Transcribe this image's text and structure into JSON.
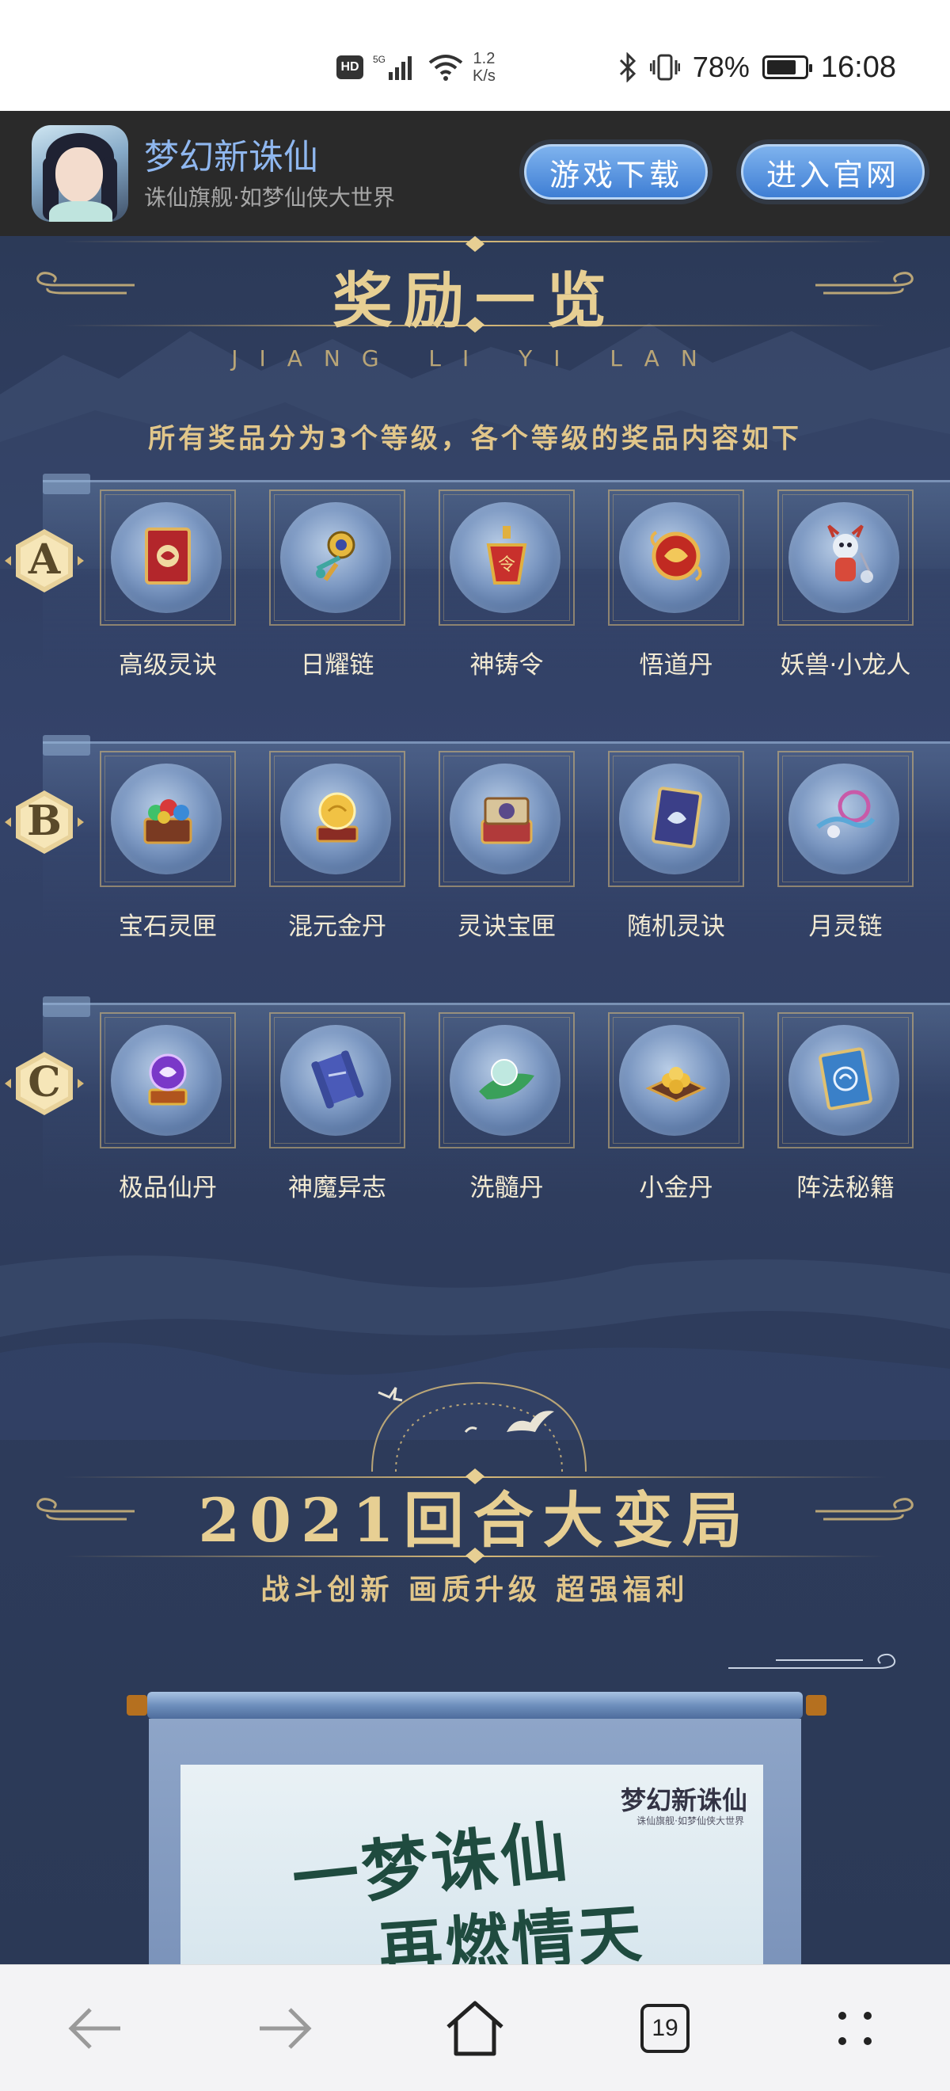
{
  "status_bar": {
    "hd": "HD",
    "net_speed_value": "1.2",
    "net_speed_unit": "K/s",
    "battery_pct": "78%",
    "battery_level": 0.78,
    "time": "16:08"
  },
  "app_banner": {
    "title": "梦幻新诛仙",
    "subtitle": "诛仙旗舰·如梦仙侠大世界",
    "download_label": "游戏下载",
    "official_label": "进入官网"
  },
  "rewards": {
    "title": "奖励一览",
    "pinyin": "JIANG LI YI LAN",
    "description": "所有奖品分为3个等级，各个等级的奖品内容如下",
    "tiers": [
      {
        "letter": "A",
        "items": [
          {
            "label": "高级灵诀",
            "icon": "red-book-icon"
          },
          {
            "label": "日耀链",
            "icon": "gold-chain-icon"
          },
          {
            "label": "神铸令",
            "icon": "red-token-icon"
          },
          {
            "label": "悟道丹",
            "icon": "red-pill-icon"
          },
          {
            "label": "妖兽·小龙人",
            "icon": "dragon-pet-icon"
          }
        ]
      },
      {
        "letter": "B",
        "items": [
          {
            "label": "宝石灵匣",
            "icon": "gem-chest-icon"
          },
          {
            "label": "混元金丹",
            "icon": "gold-orb-icon"
          },
          {
            "label": "灵诀宝匣",
            "icon": "book-box-icon"
          },
          {
            "label": "随机灵诀",
            "icon": "blue-book-icon"
          },
          {
            "label": "月灵链",
            "icon": "moon-chain-icon"
          }
        ]
      },
      {
        "letter": "C",
        "items": [
          {
            "label": "极品仙丹",
            "icon": "purple-pill-icon"
          },
          {
            "label": "神魔异志",
            "icon": "scroll-icon"
          },
          {
            "label": "洗髓丹",
            "icon": "jade-pill-icon"
          },
          {
            "label": "小金丹",
            "icon": "gold-pills-icon"
          },
          {
            "label": "阵法秘籍",
            "icon": "array-book-icon"
          }
        ]
      }
    ]
  },
  "events": {
    "title": "2021回合大变局",
    "subtitle": "战斗创新  画质升级  超强福利"
  },
  "poster": {
    "line1": "一梦诛仙",
    "line2": "再燃情天",
    "logo": "梦幻新诛仙",
    "logo_sub": "诛仙旗舰·如梦仙侠大世界"
  },
  "bottom_nav": {
    "tab_count": "19"
  }
}
